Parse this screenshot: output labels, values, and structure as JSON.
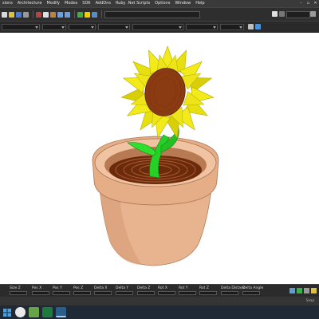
{
  "menu": {
    "items": [
      "sions",
      "Architecture",
      "Modify",
      "Modes",
      "SDK",
      "AddOns",
      "Ruby .Net Scripts",
      "Options",
      "Window",
      "Help"
    ]
  },
  "fields": [
    {
      "label": "Size Z"
    },
    {
      "label": "Pos X"
    },
    {
      "label": "Pos Y"
    },
    {
      "label": "Pos Z"
    },
    {
      "label": "Delta X"
    },
    {
      "label": "Delta Y"
    },
    {
      "label": "Delta Z"
    },
    {
      "label": "Rot X"
    },
    {
      "label": "Rot Y"
    },
    {
      "label": "Rot Z"
    },
    {
      "label": "Delta Distanc"
    },
    {
      "label": "Delta Angle"
    }
  ],
  "status": {
    "snap_label": "Snap"
  },
  "colors": {
    "pot": "#e8b490",
    "pot_shadow": "#c98f68",
    "soil": "#6b2a0a",
    "petal": "#f3ea1a",
    "petal_shadow": "#c7c200",
    "disc": "#8a3b12",
    "stem": "#26d026"
  }
}
